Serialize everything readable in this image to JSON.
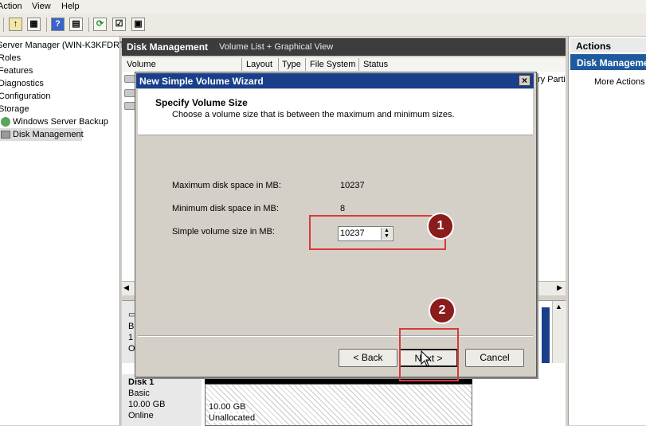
{
  "menu": {
    "action": "Action",
    "view": "View",
    "help": "Help"
  },
  "tree": {
    "root": "Server Manager (WIN-K3KFDRTSL0",
    "items": [
      "Roles",
      "Features",
      "Diagnostics",
      "Configuration",
      "Storage",
      "Windows Server Backup",
      "Disk Management"
    ]
  },
  "center": {
    "title": "Disk Management",
    "subtitle": "Volume List + Graphical View",
    "columns": [
      "Volume",
      "Layout",
      "Type",
      "File System",
      "Status"
    ],
    "partition_fragment": "ry Partit"
  },
  "disk_fragment": {
    "line1": "B",
    "line2": "1",
    "line3": "O"
  },
  "disk1": {
    "name": "Disk 1",
    "type": "Basic",
    "size": "10.00 GB",
    "status": "Online",
    "part_size": "10.00 GB",
    "part_status": "Unallocated"
  },
  "actions": {
    "title": "Actions",
    "section": "Disk Manageme",
    "more": "More Actions"
  },
  "dialog": {
    "title": "New Simple Volume Wizard",
    "header": "Specify Volume Size",
    "description": "Choose a volume size that is between the maximum and minimum sizes.",
    "max_label": "Maximum disk space in MB:",
    "max_value": "10237",
    "min_label": "Minimum disk space in MB:",
    "min_value": "8",
    "size_label": "Simple volume size in MB:",
    "size_value": "10237",
    "back": "< Back",
    "next": "Next >",
    "cancel": "Cancel"
  },
  "annotations": {
    "badge1": "1",
    "badge2": "2"
  },
  "colors": {
    "annotation": "#d83a3a",
    "badge": "#8b1c1c",
    "title_bar": "#1a3f8a"
  }
}
